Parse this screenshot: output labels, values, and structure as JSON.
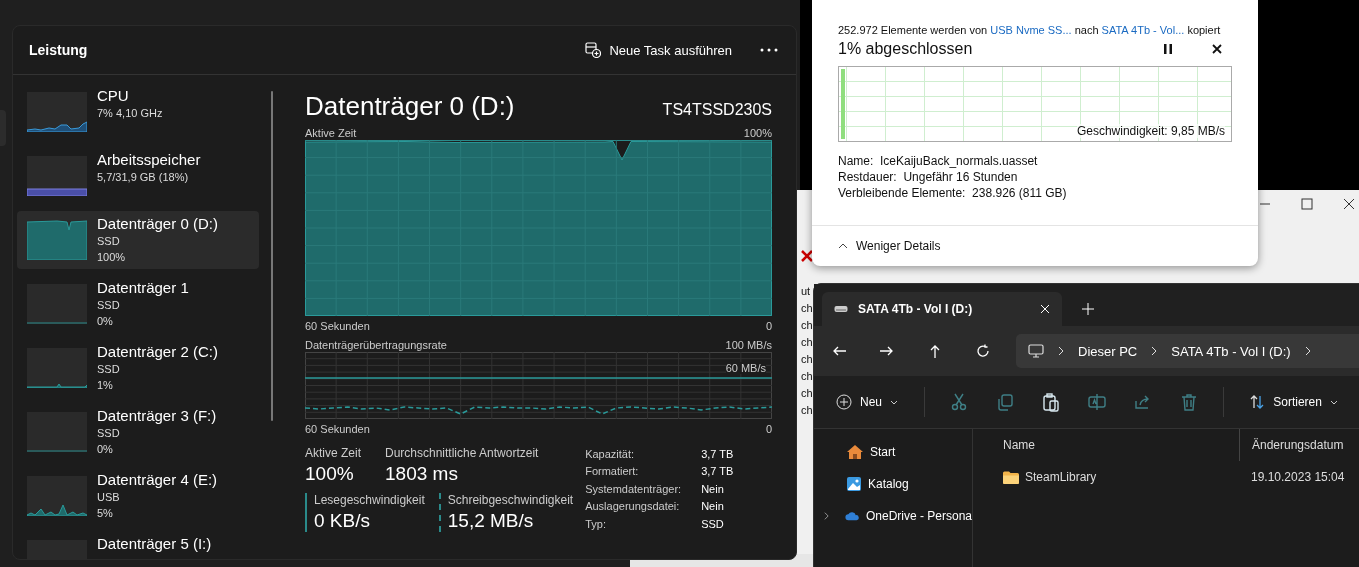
{
  "task_manager": {
    "title": "Leistung",
    "run_task": "Neue Task ausführen",
    "devices": [
      {
        "name": "CPU",
        "lines": [
          "7%  4,10 GHz"
        ],
        "kind": "cpu",
        "selected": false
      },
      {
        "name": "Arbeitsspeicher",
        "lines": [
          "5,7/31,9 GB (18%)"
        ],
        "kind": "memory",
        "selected": false
      },
      {
        "name": "Datenträger 0 (D:)",
        "lines": [
          "SSD",
          "100%"
        ],
        "kind": "busy",
        "selected": true
      },
      {
        "name": "Datenträger 1",
        "lines": [
          "SSD",
          "0%"
        ],
        "kind": "idle",
        "selected": false
      },
      {
        "name": "Datenträger 2 (C:)",
        "lines": [
          "SSD",
          "1%"
        ],
        "kind": "blip",
        "selected": false
      },
      {
        "name": "Datenträger 3 (F:)",
        "lines": [
          "SSD",
          "0%"
        ],
        "kind": "idle",
        "selected": false
      },
      {
        "name": "Datenträger 4 (E:)",
        "lines": [
          "USB",
          "5%"
        ],
        "kind": "spiky",
        "selected": false
      },
      {
        "name": "Datenträger 5 (I:)",
        "kind": "idle",
        "selected": false
      }
    ],
    "detail": {
      "title": "Datenträger 0 (D:)",
      "model": "TS4TSSD230S",
      "active_chart": {
        "label": "Aktive Zeit",
        "max": "100%",
        "time": "60 Sekunden",
        "min": "0"
      },
      "rate_chart": {
        "label": "Datenträgerübertragungsrate",
        "max": "100 MB/s",
        "mid": "60 MB/s",
        "time": "60 Sekunden",
        "min": "0"
      },
      "big_stats": [
        {
          "label": "Aktive Zeit",
          "value": "100%"
        },
        {
          "label": "Durchschnittliche Antwortzeit",
          "value": "1803 ms"
        }
      ],
      "speeds": [
        {
          "label": "Lesegeschwindigkeit",
          "value": "0 KB/s",
          "kind": "solid"
        },
        {
          "label": "Schreibgeschwindigkeit",
          "value": "15,2 MB/s",
          "kind": "dashed"
        }
      ],
      "properties": [
        {
          "label": "Kapazität:",
          "value": "3,7 TB"
        },
        {
          "label": "Formatiert:",
          "value": "3,7 TB"
        },
        {
          "label": "Systemdatenträger:",
          "value": "Nein"
        },
        {
          "label": "Auslagerungsdatei:",
          "value": "Nein"
        },
        {
          "label": "Typ:",
          "value": "SSD"
        }
      ]
    }
  },
  "copy_dialog": {
    "summary": [
      {
        "kind": "text",
        "text": "252.972 Elemente werden von"
      },
      {
        "kind": "link",
        "text": "USB Nvme SS..."
      },
      {
        "kind": "text",
        "text": "nach"
      },
      {
        "kind": "link",
        "text": "SATA 4Tb - Vol..."
      },
      {
        "kind": "text",
        "text": "kopiert"
      }
    ],
    "status": "1% abgeschlossen",
    "graph": {
      "level": 0.01,
      "speed": "Geschwindigkeit: 9,85 MB/s"
    },
    "details": [
      {
        "label": "Name:",
        "value": "IceKaijuBack_normals.uasset"
      },
      {
        "label": "Restdauer:",
        "value": "Ungefähr 16 Stunden"
      },
      {
        "label": "Verbleibende Elemente:",
        "value": "238.926 (811 GB)"
      }
    ],
    "toggle": "Weniger Details"
  },
  "explorer": {
    "tab": "SATA 4Tb - Vol I (D:)",
    "breadcrumbs": [
      "Dieser PC",
      "SATA 4Tb - Vol I (D:)"
    ],
    "new_button": "Neu",
    "sort_button": "Sortieren",
    "tools": [
      {
        "kind": "cut",
        "disabled": true
      },
      {
        "kind": "copy",
        "disabled": true
      },
      {
        "kind": "paste",
        "disabled": false
      },
      {
        "kind": "rename",
        "disabled": true
      },
      {
        "kind": "share",
        "disabled": true
      },
      {
        "kind": "delete",
        "disabled": true
      }
    ],
    "nav": [
      {
        "label": "Start",
        "kind": "home",
        "expandable": false
      },
      {
        "label": "Katalog",
        "kind": "gallery",
        "expandable": false
      },
      {
        "label": "OneDrive - Persona",
        "kind": "cloud",
        "expandable": true
      }
    ],
    "columns": [
      "Name",
      "Änderungsdatum"
    ],
    "rows": [
      {
        "name": "SteamLibrary",
        "date": "19.10.2023 15:04"
      }
    ]
  },
  "background_window": {
    "fragments": [
      "ut",
      "ch",
      "ch",
      "ch",
      "ch",
      "ch",
      "ch",
      "ch"
    ]
  }
}
